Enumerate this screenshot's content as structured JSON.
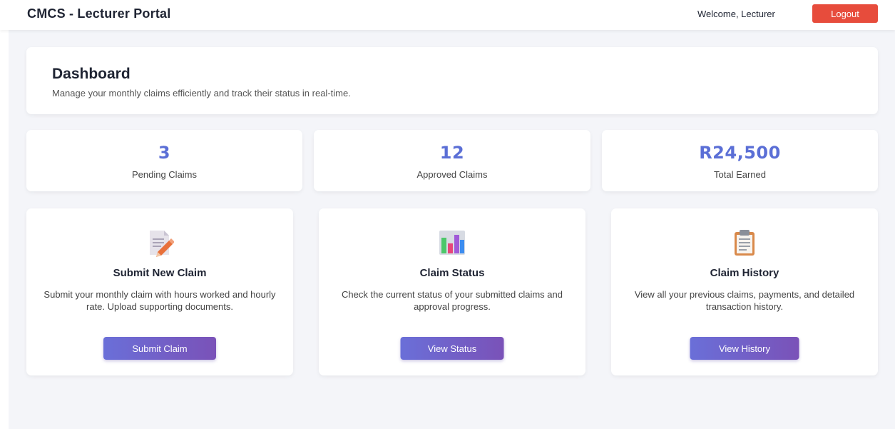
{
  "header": {
    "brand": "CMCS - Lecturer Portal",
    "welcome": "Welcome, Lecturer",
    "logout_label": "Logout"
  },
  "dashboard": {
    "title": "Dashboard",
    "subtitle": "Manage your monthly claims efficiently and track their status in real-time."
  },
  "stats": [
    {
      "value": "3",
      "label": "Pending Claims"
    },
    {
      "value": "12",
      "label": "Approved Claims"
    },
    {
      "value": "R24,500",
      "label": "Total Earned"
    }
  ],
  "features": [
    {
      "icon": "memo-pencil-icon",
      "title": "Submit New Claim",
      "description": "Submit your monthly claim with hours worked and hourly rate. Upload supporting documents.",
      "button": "Submit Claim"
    },
    {
      "icon": "bar-chart-icon",
      "title": "Claim Status",
      "description": "Check the current status of your submitted claims and approval progress.",
      "button": "View Status"
    },
    {
      "icon": "clipboard-icon",
      "title": "Claim History",
      "description": "View all your previous claims, payments, and detailed transaction history.",
      "button": "View History"
    }
  ],
  "colors": {
    "accent": "#5b6fd6",
    "logout": "#e74c3c",
    "button_gradient_start": "#6a6fd8",
    "button_gradient_end": "#7a52b8",
    "background": "#f4f5f9"
  }
}
